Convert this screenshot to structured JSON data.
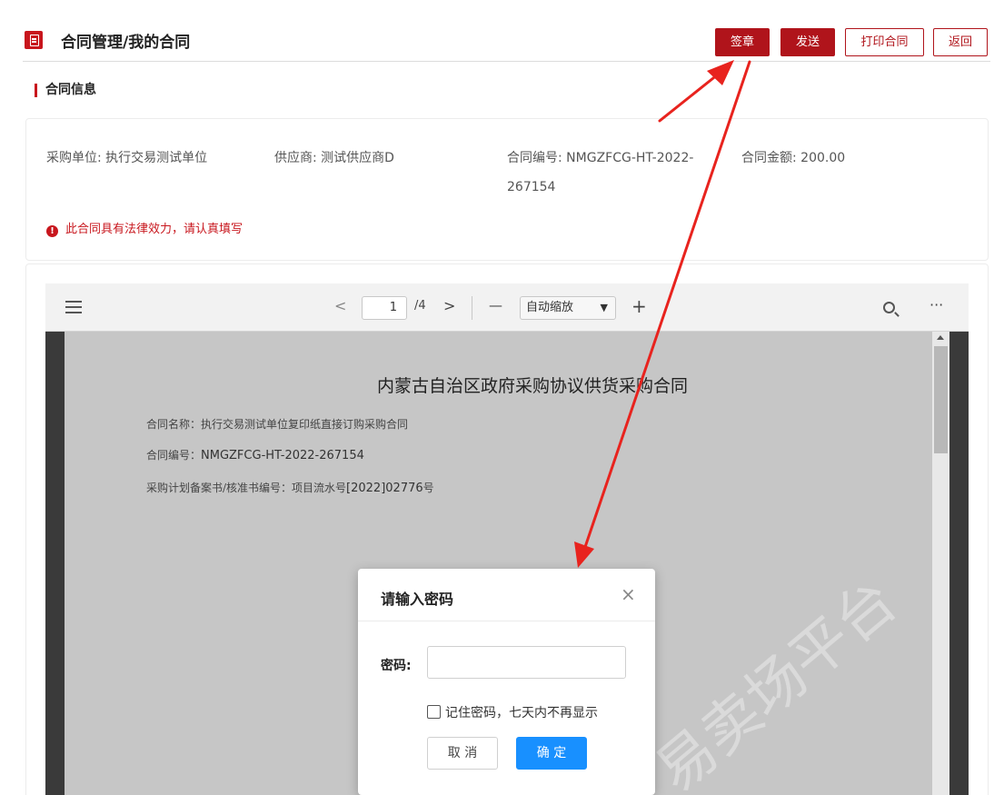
{
  "header": {
    "title": "合同管理/我的合同",
    "buttons": {
      "sign": "签章",
      "send": "发送",
      "print": "打印合同",
      "back": "返回"
    }
  },
  "section": {
    "title": "合同信息"
  },
  "info": {
    "purchaser": "采购单位: 执行交易测试单位",
    "supplier": "供应商: 测试供应商D",
    "contract_no_line1": "合同编号: NMGZFCG-HT-2022-",
    "contract_no_line2": "267154",
    "amount": "合同金额: 200.00",
    "warning": "此合同具有法律效力，请认真填写",
    "warning_icon": "!"
  },
  "viewer": {
    "prev": "<",
    "page": "1",
    "page_total": "/4",
    "next": ">",
    "zoom_out": "—",
    "zoom": "自动缩放",
    "zoom_in": "+",
    "more": "···",
    "document": {
      "title": "内蒙古自治区政府采购协议供货采购合同",
      "name_label": "合同名称：执行交易测试单位复印纸直接订购采购合同",
      "no_label": "合同编号：",
      "no_value": "NMGZFCG-HT-2022-267154",
      "plan_label": "采购计划备案书/核准书编号：项目流水号",
      "plan_value": "[2022]02776",
      "plan_suffix": "号",
      "watermark": "易卖场平台"
    }
  },
  "modal": {
    "title": "请输入密码",
    "close": "×",
    "password_label": "密码:",
    "password_value": "",
    "remember": "记住密码，七天内不再显示",
    "cancel": "取 消",
    "confirm": "确 定"
  },
  "colors": {
    "brand_red": "#b0141b",
    "primary_blue": "#1890ff",
    "arrow_red": "#e8231e"
  }
}
